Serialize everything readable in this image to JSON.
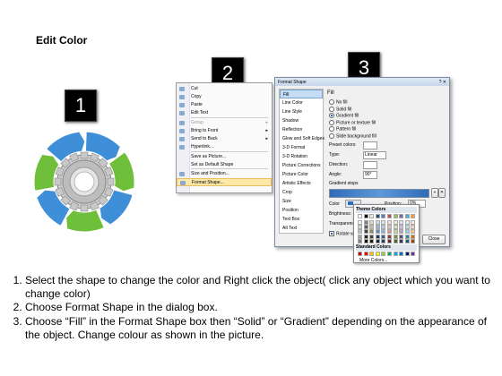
{
  "heading": "Edit Color",
  "steps": {
    "badge1": "1",
    "badge2": "2",
    "badge3": "3"
  },
  "diagram": {
    "arrow_colors": [
      "#3f8fd8",
      "#6fbf3b",
      "#3f8fd8",
      "#6fbf3b",
      "#3f8fd8",
      "#6fbf3b",
      "#3f8fd8"
    ],
    "gear_color": "#9a9a9a"
  },
  "context_menu": {
    "items": [
      {
        "label": "Cut",
        "icon": "scissors-icon",
        "state": "normal"
      },
      {
        "label": "Copy",
        "icon": "copy-icon",
        "state": "normal"
      },
      {
        "label": "Paste",
        "icon": "paste-icon",
        "state": "normal"
      },
      {
        "label": "Edit Text",
        "icon": "edit-text-icon",
        "state": "normal"
      },
      {
        "label": "Group",
        "icon": "group-icon",
        "state": "dim",
        "arrow": "▸"
      },
      {
        "label": "Bring to Front",
        "icon": "bring-front-icon",
        "state": "normal",
        "arrow": "▸"
      },
      {
        "label": "Send to Back",
        "icon": "send-back-icon",
        "state": "normal",
        "arrow": "▸"
      },
      {
        "label": "Hyperlink...",
        "icon": "hyperlink-icon",
        "state": "normal"
      },
      {
        "label": "Save as Picture...",
        "icon": "",
        "state": "normal"
      },
      {
        "label": "Set as Default Shape",
        "icon": "",
        "state": "normal"
      },
      {
        "label": "Size and Position...",
        "icon": "size-icon",
        "state": "normal"
      },
      {
        "label": "Format Shape...",
        "icon": "format-shape-icon",
        "state": "highlight"
      }
    ]
  },
  "dialog": {
    "title": "Format Shape",
    "nav": [
      "Fill",
      "Line Color",
      "Line Style",
      "Shadow",
      "Reflection",
      "Glow and Soft Edges",
      "3-D Format",
      "3-D Rotation",
      "Picture Corrections",
      "Picture Color",
      "Artistic Effects",
      "Crop",
      "Size",
      "Position",
      "Text Box",
      "Alt Text"
    ],
    "section": "Fill",
    "options": [
      "No fill",
      "Solid fill",
      "Gradient fill",
      "Picture or texture fill",
      "Pattern fill",
      "Slide background fill"
    ],
    "selected_option": "Gradient fill",
    "preset_colors": "Preset colors:",
    "type_label": "Type:",
    "type_value": "Linear",
    "direction_label": "Direction:",
    "angle_label": "Angle:",
    "angle_value": "90°",
    "gradient_stops": "Gradient stops",
    "color_label": "Color",
    "position_label": "Position:",
    "position_value": "0%",
    "brightness_label": "Brightness:",
    "transparency_label": "Transparency:",
    "rotate_label": "Rotate with shape",
    "close_button": "Close"
  },
  "palette": {
    "theme_header": "Theme Colors",
    "standard_header": "Standard Colors",
    "more_colors": "More Colors...",
    "theme_top": [
      "#ffffff",
      "#000000",
      "#eeece1",
      "#1f497d",
      "#4f81bd",
      "#c0504d",
      "#9bbb59",
      "#8064a2",
      "#4bacc6",
      "#f79646"
    ],
    "theme_shades": [
      [
        "#f2f2f2",
        "#7f7f7f",
        "#ddd9c3",
        "#c6d9f0",
        "#dbe5f1",
        "#f2dcdb",
        "#ebf1dd",
        "#e5e0ec",
        "#dbeef3",
        "#fdeada"
      ],
      [
        "#d8d8d8",
        "#595959",
        "#c4bd97",
        "#8db3e2",
        "#b8cce4",
        "#e5b9b7",
        "#d7e3bc",
        "#ccc1d9",
        "#b7dde8",
        "#fbd5b5"
      ],
      [
        "#bfbfbf",
        "#3f3f3f",
        "#938953",
        "#548dd4",
        "#95b3d7",
        "#d99694",
        "#c3d69b",
        "#b2a2c7",
        "#92cddc",
        "#fac08f"
      ],
      [
        "#a5a5a5",
        "#262626",
        "#494429",
        "#17365d",
        "#366092",
        "#953734",
        "#76923c",
        "#5f497a",
        "#31859b",
        "#e36c09"
      ],
      [
        "#7f7f7f",
        "#0c0c0c",
        "#1d1b10",
        "#0f243e",
        "#244061",
        "#632423",
        "#4f6128",
        "#3f3151",
        "#205867",
        "#974806"
      ]
    ],
    "standard": [
      "#c00000",
      "#ff0000",
      "#ffc000",
      "#ffff00",
      "#92d050",
      "#00b050",
      "#00b0f0",
      "#0070c0",
      "#002060",
      "#7030a0"
    ]
  },
  "instructions": [
    "Select the shape to change the color and Right click the object( click any object which you want to change color)",
    "Choose Format Shape in the dialog box.",
    "Choose “Fill” in the Format Shape box then “Solid” or “Gradient” depending on the appearance of the object. Change colour as shown in the picture."
  ]
}
